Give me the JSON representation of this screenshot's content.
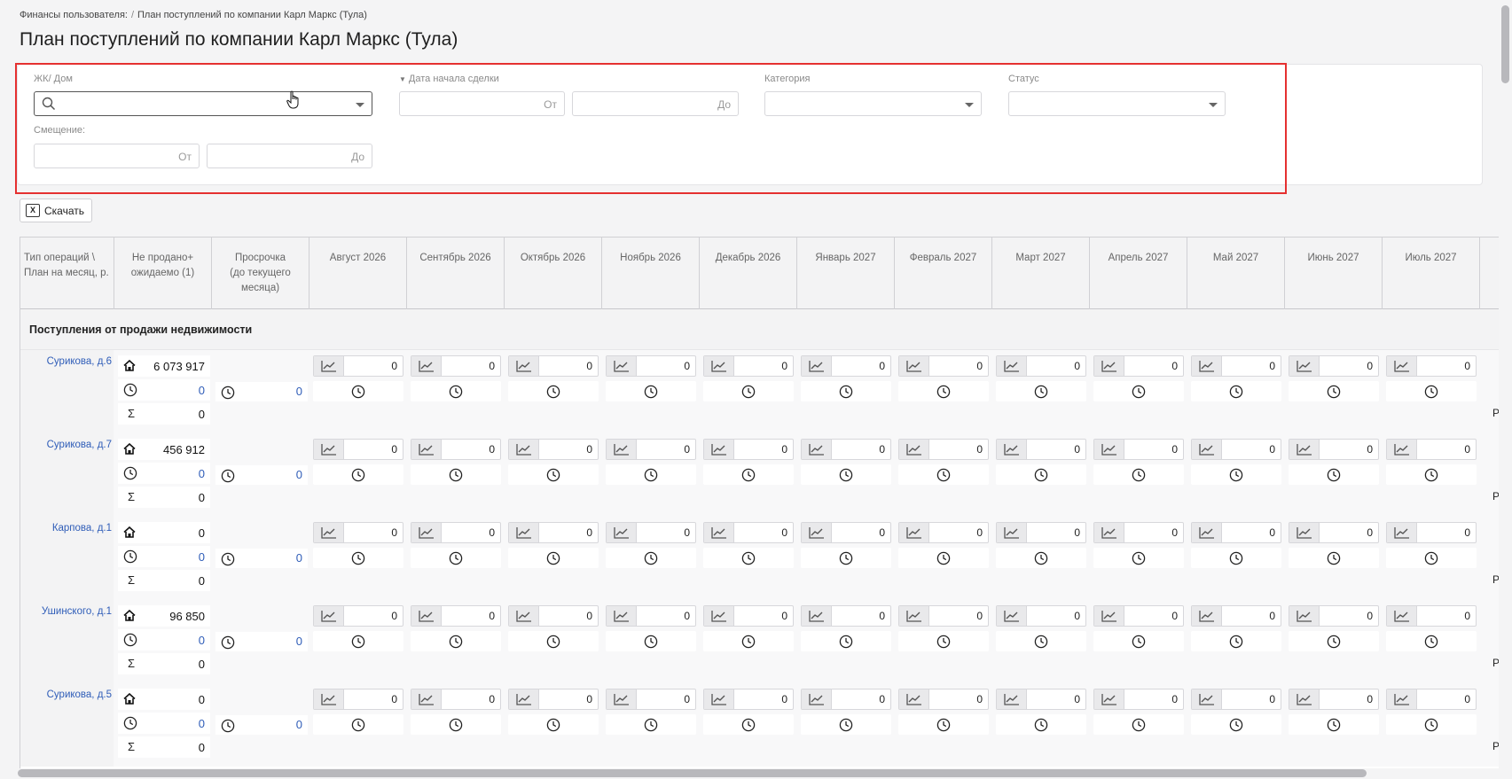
{
  "breadcrumb": {
    "root": "Финансы пользователя:",
    "separator": "/",
    "current": "План поступлений по компании Карл Маркс (Тула)"
  },
  "page_title": "План поступлений по компании Карл Маркс (Тула)",
  "filters": {
    "complex_label": "ЖК/ Дом",
    "deal_start_label": "Дата начала сделки",
    "category_label": "Категория",
    "status_label": "Статус",
    "offset_label": "Смещение:",
    "from_placeholder": "От",
    "to_placeholder": "До"
  },
  "toolbar": {
    "download_label": "Скачать"
  },
  "table": {
    "col_type": "Тип операций \\ План на месяц, р.",
    "col_unsold": "Не продано+ ожидаемо (1)",
    "col_overdue": "Просрочка (до текущего месяца)",
    "months": [
      "Август 2026",
      "Сентябрь 2026",
      "Октябрь 2026",
      "Ноябрь 2026",
      "Декабрь 2026",
      "Январь 2027",
      "Февраль 2027",
      "Март 2027",
      "Апрель 2027",
      "Май 2027",
      "Июнь 2027",
      "Июль 2027"
    ],
    "section_title": "Поступления от продажи недвижимости",
    "sigma_symbol": "Σ",
    "cut_label": "Р",
    "rows": [
      {
        "name": "Сурикова, д.6",
        "unsold": "6 073 917",
        "expected": "0",
        "total": "0",
        "overdue": "0",
        "months": [
          "0",
          "0",
          "0",
          "0",
          "0",
          "0",
          "0",
          "0",
          "0",
          "0",
          "0",
          "0"
        ]
      },
      {
        "name": "Сурикова, д.7",
        "unsold": "456 912",
        "expected": "0",
        "total": "0",
        "overdue": "0",
        "months": [
          "0",
          "0",
          "0",
          "0",
          "0",
          "0",
          "0",
          "0",
          "0",
          "0",
          "0",
          "0"
        ]
      },
      {
        "name": "Карпова, д.1",
        "unsold": "0",
        "expected": "0",
        "total": "0",
        "overdue": "0",
        "months": [
          "0",
          "0",
          "0",
          "0",
          "0",
          "0",
          "0",
          "0",
          "0",
          "0",
          "0",
          "0"
        ]
      },
      {
        "name": "Ушинского, д.1",
        "unsold": "96 850",
        "expected": "0",
        "total": "0",
        "overdue": "0",
        "months": [
          "0",
          "0",
          "0",
          "0",
          "0",
          "0",
          "0",
          "0",
          "0",
          "0",
          "0",
          "0"
        ]
      },
      {
        "name": "Сурикова, д.5",
        "unsold": "0",
        "expected": "0",
        "total": "0",
        "overdue": "0",
        "months": [
          "0",
          "0",
          "0",
          "0",
          "0",
          "0",
          "0",
          "0",
          "0",
          "0",
          "0",
          "0"
        ]
      }
    ]
  },
  "icons": {
    "search": "search-icon",
    "house": "house-icon",
    "clock": "clock-icon",
    "chart": "trend-chart-icon",
    "excel": "excel-icon",
    "cursor": "hand-cursor-icon"
  },
  "colors": {
    "highlight": "#e53030",
    "link": "#2f5db8"
  }
}
